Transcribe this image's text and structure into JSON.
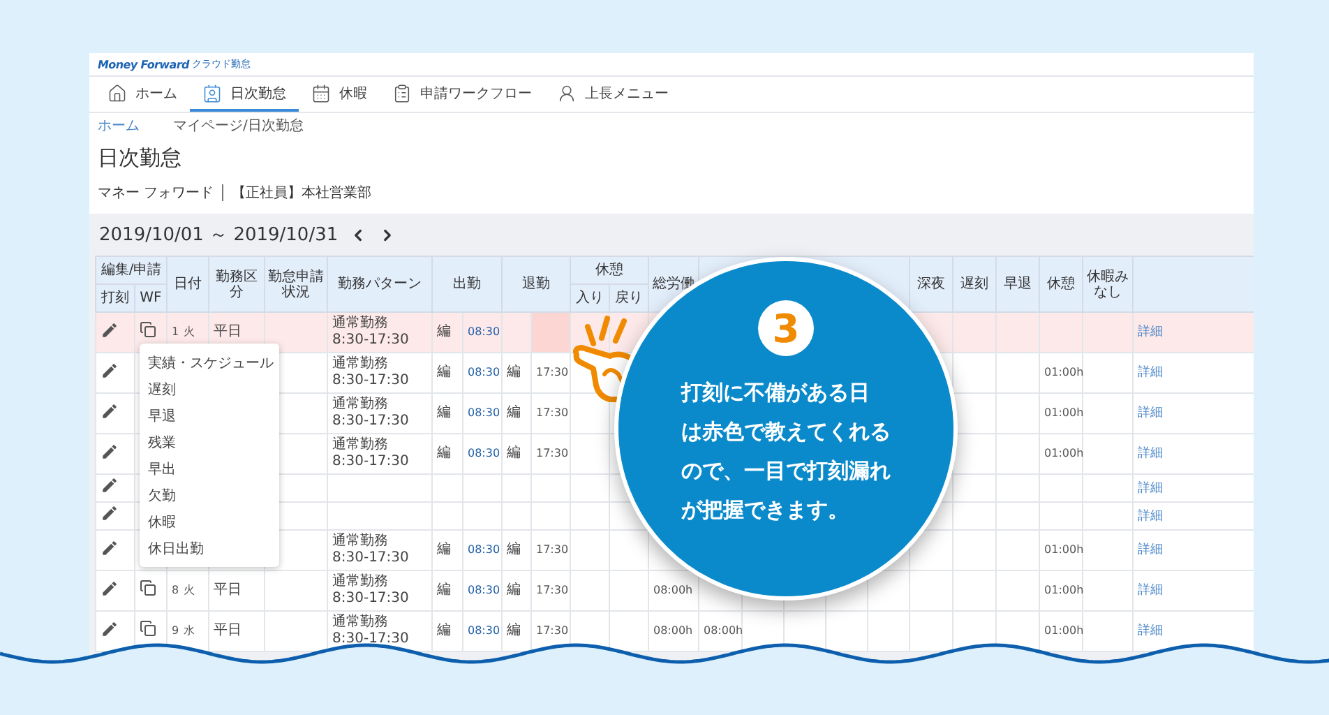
{
  "brand": {
    "logo": "Money Forward",
    "product": "クラウド勤怠"
  },
  "nav": [
    {
      "label": "ホーム",
      "selected": false
    },
    {
      "label": "日次勤怠",
      "selected": true
    },
    {
      "label": "休暇",
      "selected": false
    },
    {
      "label": "申請ワークフロー",
      "selected": false
    },
    {
      "label": "上長メニュー",
      "selected": false
    }
  ],
  "breadcrumb": [
    "ホーム",
    "マイページ/日次勤怠"
  ],
  "page_title": "日次勤怠",
  "employee": {
    "name": "マネー フォワード",
    "department": "【正社員】本社営業部"
  },
  "period": "2019/10/01 ～ 2019/10/31",
  "table": {
    "columns": {
      "edit_group": "編集/申請",
      "stamp": "打刻",
      "wf": "WF",
      "date": "日付",
      "category": "勤務区分",
      "request_status": "勤怠申請状況",
      "pattern": "勤務パターン",
      "clock_in": "出勤",
      "clock_out": "退勤",
      "break_group": "休憩",
      "break_in": "入り",
      "break_out": "戻り",
      "total": "総労働",
      "late_night": "深夜",
      "late": "遅刻",
      "early_leave": "早退",
      "break": "休憩",
      "leave_deemed": "休暇みなし"
    },
    "rows": [
      {
        "kind": "workday",
        "missing_stamp": true,
        "date": "1",
        "weekday": "火",
        "category": "平日",
        "pattern": "通常勤務 8:30-17:30",
        "in_mark": "編",
        "in_time": "08:30",
        "detail": "詳細"
      },
      {
        "kind": "workday",
        "missing_stamp": false,
        "pattern": "通常勤務 8:30-17:30",
        "in_mark": "編",
        "in_time": "08:30",
        "out_mark": "編",
        "out_time": "17:30",
        "break": "01:00h",
        "detail": "詳細"
      },
      {
        "kind": "workday",
        "missing_stamp": false,
        "pattern": "通常勤務 8:30-17:30",
        "in_mark": "編",
        "in_time": "08:30",
        "out_mark": "編",
        "out_time": "17:30",
        "break": "01:00h",
        "detail": "詳細"
      },
      {
        "kind": "workday",
        "missing_stamp": false,
        "pattern": "通常勤務 8:30-17:30",
        "in_mark": "編",
        "in_time": "08:30",
        "out_mark": "編",
        "out_time": "17:30",
        "break": "01:00h",
        "detail": "詳細"
      },
      {
        "kind": "holiday",
        "missing_stamp": false,
        "detail": "詳細"
      },
      {
        "kind": "holiday",
        "missing_stamp": false,
        "detail": "詳細"
      },
      {
        "kind": "workday",
        "missing_stamp": false,
        "pattern": "通常勤務 8:30-17:30",
        "in_mark": "編",
        "in_time": "08:30",
        "out_mark": "編",
        "out_time": "17:30",
        "break": "01:00h",
        "detail": "詳細"
      },
      {
        "kind": "workday",
        "missing_stamp": false,
        "date": "8",
        "weekday": "火",
        "category": "平日",
        "pattern": "通常勤務 8:30-17:30",
        "in_mark": "編",
        "in_time": "08:30",
        "out_mark": "編",
        "out_time": "17:30",
        "total": "08:00h",
        "break": "01:00h",
        "detail": "詳細"
      },
      {
        "kind": "workday",
        "missing_stamp": false,
        "date": "9",
        "weekday": "水",
        "category": "平日",
        "pattern": "通常勤務 8:30-17:30",
        "in_mark": "編",
        "in_time": "08:30",
        "out_mark": "編",
        "out_time": "17:30",
        "total": "08:00h",
        "total_2": "08:00h",
        "break": "01:00h",
        "detail": "詳細"
      }
    ]
  },
  "stamp_menu": {
    "items": [
      "実績・スケジュール",
      "遅刻",
      "早退",
      "残業",
      "早出",
      "欠勤",
      "休暇",
      "休日出勤"
    ]
  },
  "callout": {
    "number": "3",
    "lines": [
      "打刻に不備がある日",
      "は赤色で教えてくれる",
      "ので、一目で打刻漏れ",
      "が把握できます。"
    ]
  }
}
